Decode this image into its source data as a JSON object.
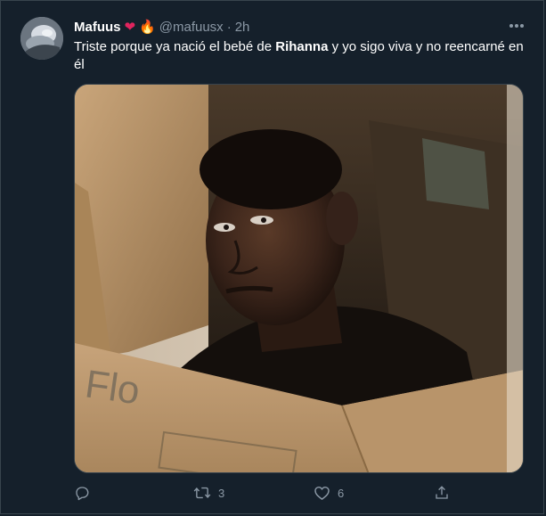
{
  "tweet": {
    "display_name": "Mafuus",
    "name_emojis": [
      "❤️",
      "🔥"
    ],
    "handle": "@mafuusx",
    "separator": "·",
    "time": "2h",
    "text_before": "Triste porque ya nació el bebé de ",
    "text_bold": "Rihanna",
    "text_after": " y yo sigo viva y no reencarné en él",
    "media_label": "Flo"
  },
  "actions": {
    "reply_count": "",
    "retweet_count": "3",
    "like_count": "6",
    "share_count": ""
  },
  "icons": {
    "more": "more-horizontal-icon",
    "reply": "reply-icon",
    "retweet": "retweet-icon",
    "like": "heart-icon",
    "share": "share-icon"
  },
  "colors": {
    "background": "#15202b",
    "secondary_text": "#8b98a5",
    "border": "#38444d",
    "heart_emoji": "#e0245e"
  }
}
